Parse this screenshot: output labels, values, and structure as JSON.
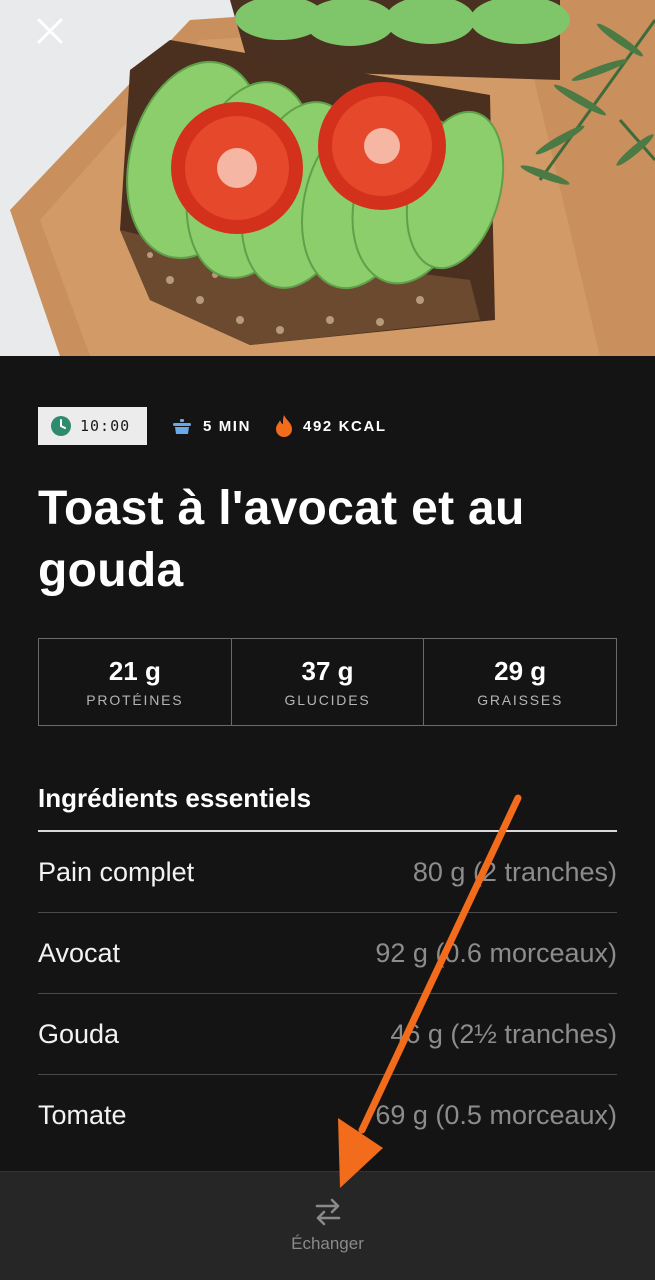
{
  "hero": {
    "image": "avocado-toast-photo"
  },
  "close_icon": "close-icon",
  "meta": {
    "time": "10:00",
    "duration": "5 MIN",
    "calories": "492 KCAL"
  },
  "recipe_title": "Toast à l'avocat et au gouda",
  "macros": [
    {
      "value": "21 g",
      "label": "PROTÉINES"
    },
    {
      "value": "37 g",
      "label": "GLUCIDES"
    },
    {
      "value": "29 g",
      "label": "GRAISSES"
    }
  ],
  "ingredients": {
    "heading": "Ingrédients essentiels",
    "items": [
      {
        "name": "Pain complet",
        "qty": "80 g (2 tranches)"
      },
      {
        "name": "Avocat",
        "qty": "92 g (0.6 morceaux)"
      },
      {
        "name": "Gouda",
        "qty": "46 g (2½ tranches)"
      },
      {
        "name": "Tomate",
        "qty": "69 g (0.5 morceaux)"
      }
    ]
  },
  "bottom_bar": {
    "label": "Échanger",
    "icon": "swap-icon"
  },
  "colors": {
    "background": "#141414",
    "bottom_bar": "#262626",
    "annotation_arrow": "#f26c1c",
    "clock_green": "#2e8b6e",
    "pot_blue": "#6aa8e8",
    "flame_orange": "#f26c1c"
  }
}
